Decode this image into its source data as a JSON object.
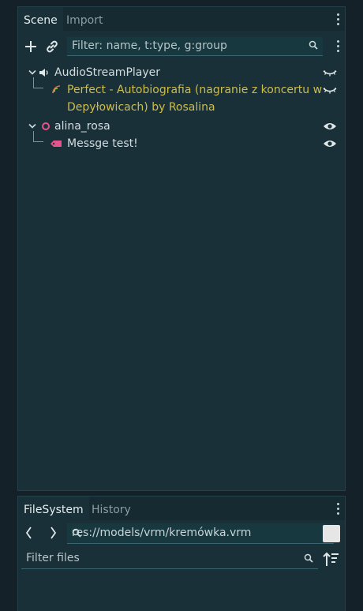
{
  "scene_panel": {
    "tabs": [
      {
        "label": "Scene",
        "active": true
      },
      {
        "label": "Import",
        "active": false
      }
    ],
    "filter": {
      "placeholder": "Filter: name, t:type, g:group",
      "value": ""
    },
    "tree": [
      {
        "name": "AudioStreamPlayer",
        "icon": "speaker-icon",
        "visibility": "hidden-icon"
      },
      {
        "name_line1": "Perfect - Autobiografia (nagranie z koncertu w",
        "name_line2": "Depyłowicach) by Rosalina",
        "icon": "audio-stream-icon",
        "visibility": "hidden-icon",
        "color": "#cdbd4a"
      },
      {
        "name": "alina_rosa",
        "icon": "node-circle-icon",
        "visibility": "eye-icon"
      },
      {
        "name": "Messge test!",
        "icon": "label-tag-icon",
        "visibility": "eye-icon"
      }
    ]
  },
  "filesystem_panel": {
    "tabs": [
      {
        "label": "FileSystem",
        "active": true
      },
      {
        "label": "History",
        "active": false
      }
    ],
    "path": "res://models/vrm/kremówka.vrm",
    "filter": {
      "placeholder": "Filter files",
      "value": ""
    }
  },
  "colors": {
    "panel_bg": "#1a3038",
    "audio_text": "#cdbd4a",
    "node_pink": "#e5548a"
  }
}
